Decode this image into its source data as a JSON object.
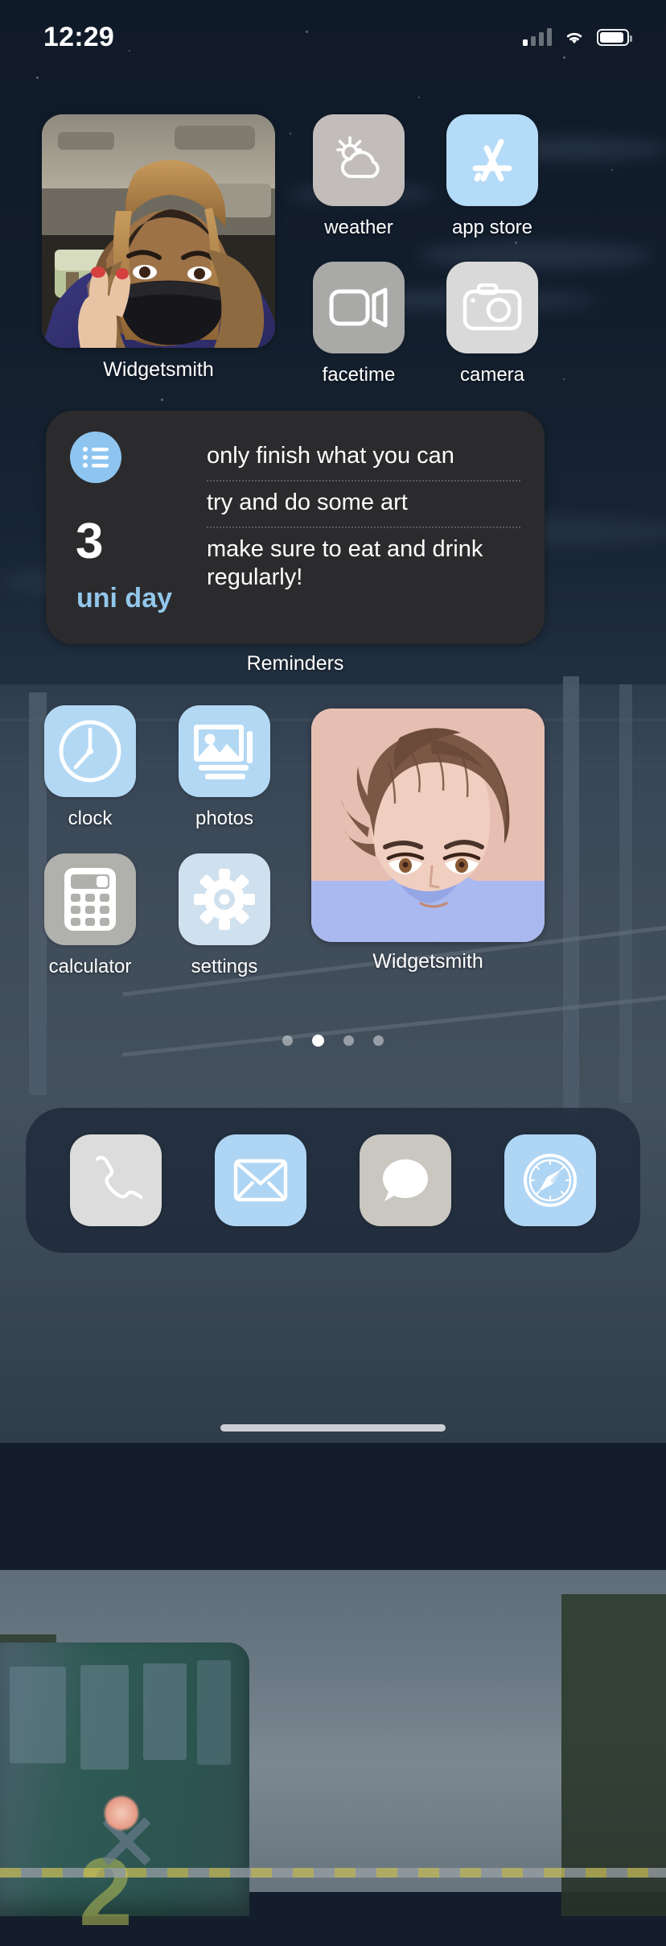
{
  "status_bar": {
    "time": "12:29",
    "signal_icon": "cellular-bars-icon",
    "wifi_icon": "wifi-icon",
    "battery_icon": "battery-icon"
  },
  "widgets": {
    "photo_widget": {
      "label": "Widgetsmith",
      "icon": "photo-widget"
    },
    "anime_widget": {
      "label": "Widgetsmith",
      "icon": "anime-photo-widget"
    },
    "reminders": {
      "caption": "Reminders",
      "list_icon": "reminders-list-icon",
      "count": "3",
      "list_name": "uni day",
      "items": [
        "only finish what you can",
        "try and do some art",
        "make sure to eat and drink regularly!"
      ],
      "accent_color": "#93c7ec",
      "background_color": "#2b2b2d"
    }
  },
  "apps": {
    "row1": [
      {
        "label": "weather",
        "icon": "weather-icon",
        "color": "#c2bdbb"
      },
      {
        "label": "app store",
        "icon": "app-store-icon",
        "color": "#b4dbf8"
      }
    ],
    "row2": [
      {
        "label": "facetime",
        "icon": "facetime-icon",
        "color": "#a9a9a7"
      },
      {
        "label": "camera",
        "icon": "camera-icon",
        "color": "#d9d9d9"
      }
    ],
    "row3": [
      {
        "label": "clock",
        "icon": "clock-icon",
        "color": "#b2d8f4"
      },
      {
        "label": "photos",
        "icon": "photos-icon",
        "color": "#b2d8f4"
      }
    ],
    "row4": [
      {
        "label": "calculator",
        "icon": "calculator-icon",
        "color": "#b0b0ad"
      },
      {
        "label": "settings",
        "icon": "settings-gear-icon",
        "color": "#cfe0ee"
      }
    ]
  },
  "page_dots": {
    "count": 4,
    "active_index": 1
  },
  "dock": {
    "items": [
      {
        "label": "phone",
        "icon": "phone-icon",
        "color": "#dcdcdc"
      },
      {
        "label": "mail",
        "icon": "mail-icon",
        "color": "#afd5f4"
      },
      {
        "label": "messages",
        "icon": "messages-icon",
        "color": "#cac7c0"
      },
      {
        "label": "safari",
        "icon": "safari-compass-icon",
        "color": "#afd5f4"
      }
    ]
  }
}
